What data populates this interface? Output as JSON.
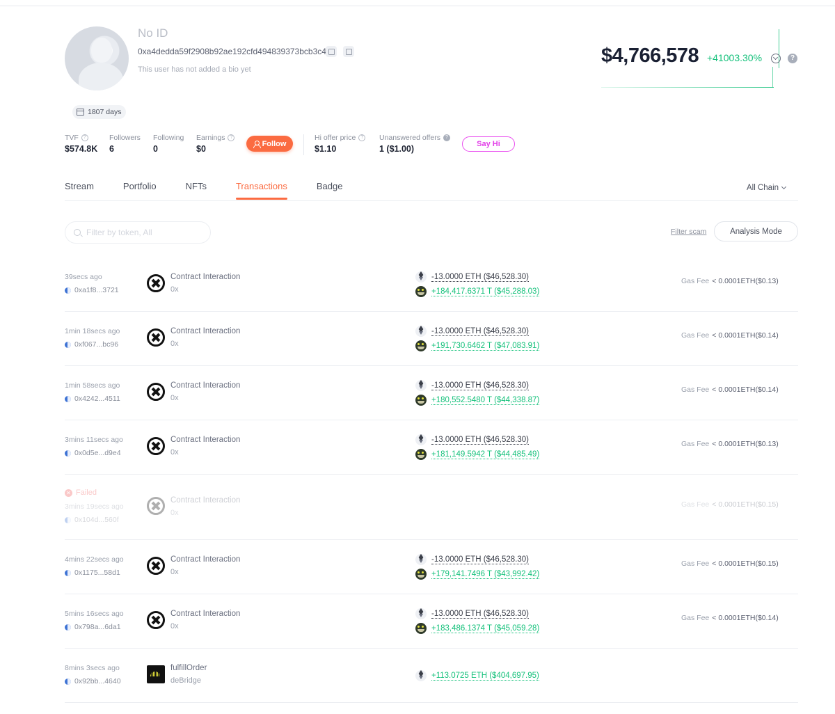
{
  "profile": {
    "name": "No ID",
    "address": "0xa4dedda59f2908b92ae192cfd494839373bcb3c4",
    "bio": "This user has not added a bio yet",
    "days": "1807 days",
    "net_worth": "$4,766,578",
    "net_worth_change": "+41003.30%"
  },
  "stats": {
    "tvf_label": "TVF",
    "tvf_value": "$574.8K",
    "followers_label": "Followers",
    "followers_value": "6",
    "following_label": "Following",
    "following_value": "0",
    "earnings_label": "Earnings",
    "earnings_value": "$0",
    "follow_button": "Follow",
    "hi_offer_label": "Hi offer price",
    "hi_offer_value": "$1.10",
    "unanswered_label": "Unanswered offers",
    "unanswered_value": "1 ($1.00)",
    "say_hi_button": "Say Hi"
  },
  "tabs": [
    {
      "label": "Stream"
    },
    {
      "label": "Portfolio"
    },
    {
      "label": "NFTs"
    },
    {
      "label": "Transactions",
      "active": true
    },
    {
      "label": "Badge"
    }
  ],
  "chain_selector": "All Chain",
  "filter": {
    "placeholder": "Filter by token, All",
    "scam_link": "Filter scam",
    "analysis_button": "Analysis Mode"
  },
  "colors": {
    "accent": "#fb6b41",
    "positive": "#15c17b",
    "say_hi": "#e23fe8",
    "failed": "#f05a5a"
  },
  "transactions": [
    {
      "time": "39secs ago",
      "hash": "0xa1f8...3721",
      "type": "Contract Interaction",
      "sub": "0x",
      "out": "-13.0000 ETH ($46,528.30)",
      "in": "+184,417.6371 T ($45,288.03)",
      "gas_label": "Gas Fee",
      "gas": "< 0.0001ETH($0.13)"
    },
    {
      "time": "1min 18secs ago",
      "hash": "0xf067...bc96",
      "type": "Contract Interaction",
      "sub": "0x",
      "out": "-13.0000 ETH ($46,528.30)",
      "in": "+191,730.6462 T ($47,083.91)",
      "gas_label": "Gas Fee",
      "gas": "< 0.0001ETH($0.14)"
    },
    {
      "time": "1min 58secs ago",
      "hash": "0x4242...4511",
      "type": "Contract Interaction",
      "sub": "0x",
      "out": "-13.0000 ETH ($46,528.30)",
      "in": "+180,552.5480 T ($44,338.87)",
      "gas_label": "Gas Fee",
      "gas": "< 0.0001ETH($0.14)"
    },
    {
      "time": "3mins 11secs ago",
      "hash": "0x0d5e...d9e4",
      "type": "Contract Interaction",
      "sub": "0x",
      "out": "-13.0000 ETH ($46,528.30)",
      "in": "+181,149.5942 T ($44,485.49)",
      "gas_label": "Gas Fee",
      "gas": "< 0.0001ETH($0.13)"
    },
    {
      "failed_label": "Failed",
      "time": "3mins 19secs ago",
      "hash": "0x104d...560f",
      "type": "Contract Interaction",
      "sub": "0x",
      "gas_label": "Gas Fee",
      "gas": "< 0.0001ETH($0.15)"
    },
    {
      "time": "4mins 22secs ago",
      "hash": "0x1175...58d1",
      "type": "Contract Interaction",
      "sub": "0x",
      "out": "-13.0000 ETH ($46,528.30)",
      "in": "+179,141.7496 T ($43,992.42)",
      "gas_label": "Gas Fee",
      "gas": "< 0.0001ETH($0.15)"
    },
    {
      "time": "5mins 16secs ago",
      "hash": "0x798a...6da1",
      "type": "Contract Interaction",
      "sub": "0x",
      "out": "-13.0000 ETH ($46,528.30)",
      "in": "+183,486.1374 T ($45,059.28)",
      "gas_label": "Gas Fee",
      "gas": "< 0.0001ETH($0.14)"
    },
    {
      "time": "8mins 3secs ago",
      "hash": "0x92bb...4640",
      "type": "fulfillOrder",
      "sub": "deBridge",
      "in": "+113.0725 ETH ($404,697.95)"
    }
  ]
}
